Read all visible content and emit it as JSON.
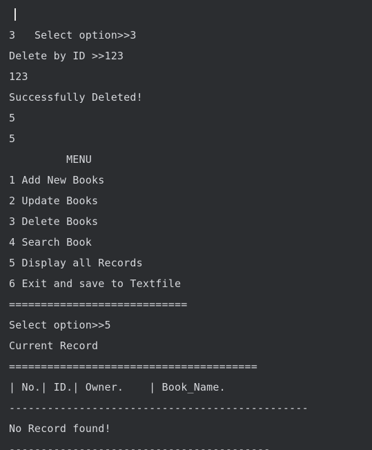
{
  "console": {
    "lines": [
      "Select option>>3",
      "3",
      "Delete by ID >>123",
      "123",
      "Successfully Deleted!",
      "5",
      "5",
      "         MENU",
      "1 Add New Books",
      "2 Update Books",
      "3 Delete Books",
      "4 Search Book",
      "5 Display all Records",
      "6 Exit and save to Textfile",
      "============================",
      "Select option>>5",
      "Current Record",
      "=======================================",
      "| No.| ID.| Owner.    | Book_Name.",
      "-----------------------------------------------",
      "No Record found!",
      "-----------------------------------------"
    ]
  }
}
